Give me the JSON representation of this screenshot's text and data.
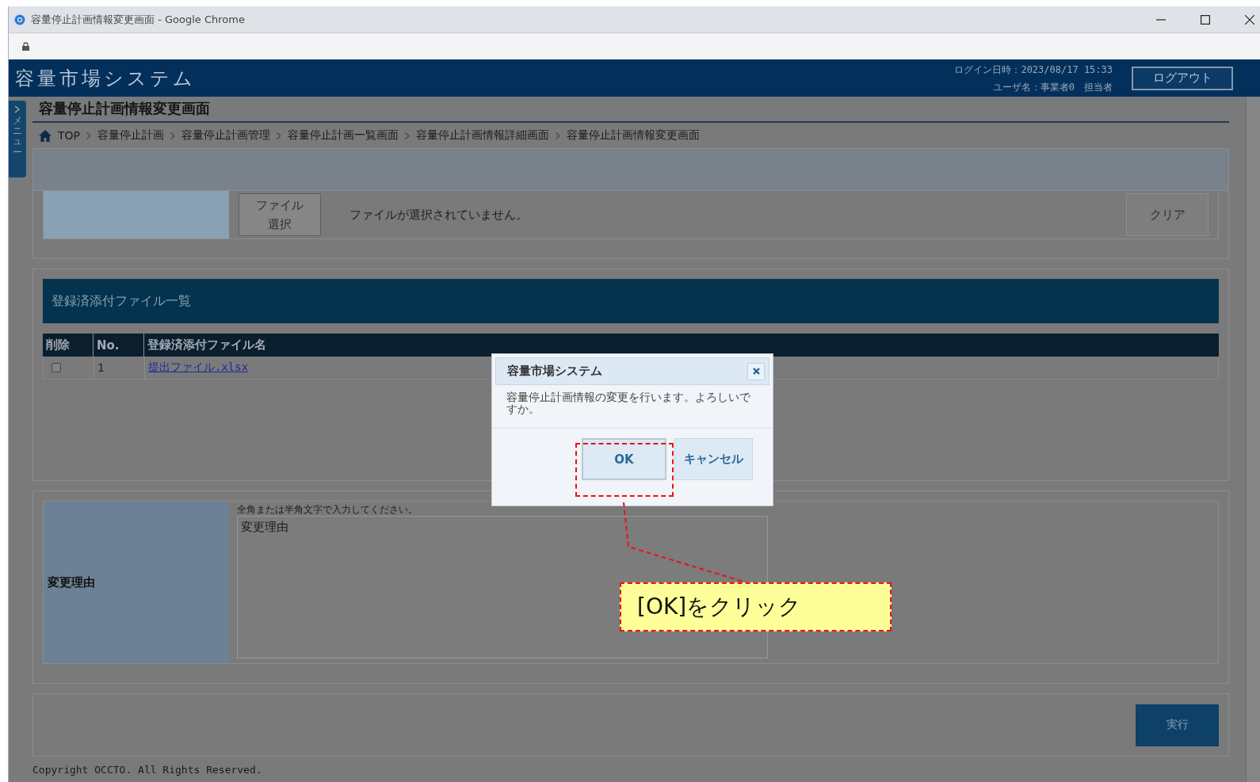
{
  "window": {
    "title": "容量停止計画情報変更画面 - Google Chrome"
  },
  "app": {
    "name": "容量市場システム",
    "login_time": "ログイン日時：2023/08/17 15:33",
    "user": "ユーザ名：事業者0　担当者",
    "logout": "ログアウト",
    "menu_tab": "メニュー"
  },
  "page_title": "容量停止計画情報変更画面",
  "breadcrumb": [
    "TOP",
    "容量停止計画",
    "容量停止計画管理",
    "容量停止計画一覧画面",
    "容量停止計画情報詳細画面",
    "容量停止計画情報変更画面"
  ],
  "file_upload": {
    "button": "ファイル選択",
    "status": "ファイルが選択されていません。",
    "clear": "クリア"
  },
  "attachments": {
    "title": "登録済添付ファイル一覧",
    "columns": [
      "削除",
      "No.",
      "登録済添付ファイル名"
    ],
    "rows": [
      {
        "checked": false,
        "no": "1",
        "file": "提出ファイル.xlsx"
      }
    ]
  },
  "reason": {
    "label": "変更理由",
    "hint": "全角または半角文字で入力してください。",
    "value": "変更理由"
  },
  "execute": "実行",
  "copyright": "Copyright OCCTO. All Rights Reserved.",
  "dialog": {
    "title": "容量市場システム",
    "message": "容量停止計画情報の変更を行います。よろしいですか。",
    "buttons": [
      {
        "label": "OK",
        "kind": "primary"
      },
      {
        "label": "キャンセル",
        "kind": "secondary"
      }
    ]
  },
  "callout": {
    "text": "[OK]をクリック"
  }
}
